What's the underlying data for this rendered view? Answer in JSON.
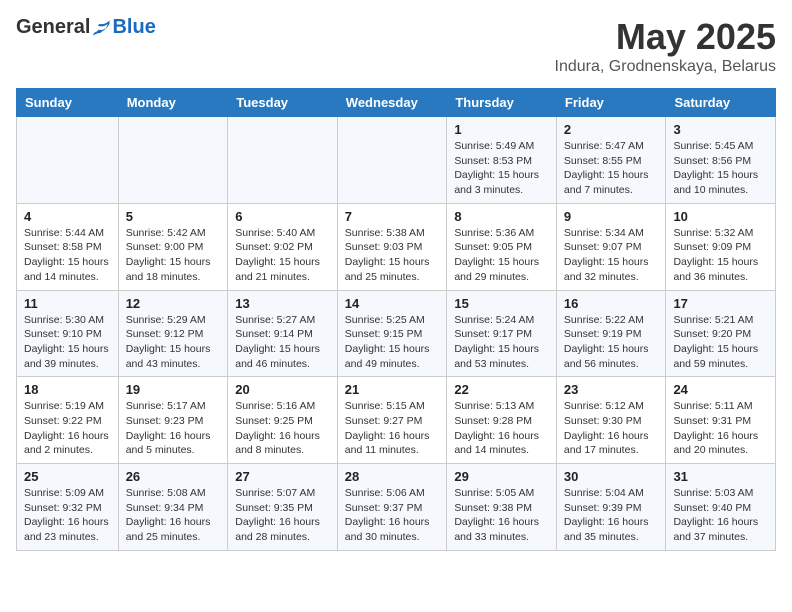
{
  "header": {
    "logo_general": "General",
    "logo_blue": "Blue",
    "month_title": "May 2025",
    "subtitle": "Indura, Grodnenskaya, Belarus"
  },
  "days_of_week": [
    "Sunday",
    "Monday",
    "Tuesday",
    "Wednesday",
    "Thursday",
    "Friday",
    "Saturday"
  ],
  "weeks": [
    [
      {
        "day": "",
        "info": ""
      },
      {
        "day": "",
        "info": ""
      },
      {
        "day": "",
        "info": ""
      },
      {
        "day": "",
        "info": ""
      },
      {
        "day": "1",
        "info": "Sunrise: 5:49 AM\nSunset: 8:53 PM\nDaylight: 15 hours\nand 3 minutes."
      },
      {
        "day": "2",
        "info": "Sunrise: 5:47 AM\nSunset: 8:55 PM\nDaylight: 15 hours\nand 7 minutes."
      },
      {
        "day": "3",
        "info": "Sunrise: 5:45 AM\nSunset: 8:56 PM\nDaylight: 15 hours\nand 10 minutes."
      }
    ],
    [
      {
        "day": "4",
        "info": "Sunrise: 5:44 AM\nSunset: 8:58 PM\nDaylight: 15 hours\nand 14 minutes."
      },
      {
        "day": "5",
        "info": "Sunrise: 5:42 AM\nSunset: 9:00 PM\nDaylight: 15 hours\nand 18 minutes."
      },
      {
        "day": "6",
        "info": "Sunrise: 5:40 AM\nSunset: 9:02 PM\nDaylight: 15 hours\nand 21 minutes."
      },
      {
        "day": "7",
        "info": "Sunrise: 5:38 AM\nSunset: 9:03 PM\nDaylight: 15 hours\nand 25 minutes."
      },
      {
        "day": "8",
        "info": "Sunrise: 5:36 AM\nSunset: 9:05 PM\nDaylight: 15 hours\nand 29 minutes."
      },
      {
        "day": "9",
        "info": "Sunrise: 5:34 AM\nSunset: 9:07 PM\nDaylight: 15 hours\nand 32 minutes."
      },
      {
        "day": "10",
        "info": "Sunrise: 5:32 AM\nSunset: 9:09 PM\nDaylight: 15 hours\nand 36 minutes."
      }
    ],
    [
      {
        "day": "11",
        "info": "Sunrise: 5:30 AM\nSunset: 9:10 PM\nDaylight: 15 hours\nand 39 minutes."
      },
      {
        "day": "12",
        "info": "Sunrise: 5:29 AM\nSunset: 9:12 PM\nDaylight: 15 hours\nand 43 minutes."
      },
      {
        "day": "13",
        "info": "Sunrise: 5:27 AM\nSunset: 9:14 PM\nDaylight: 15 hours\nand 46 minutes."
      },
      {
        "day": "14",
        "info": "Sunrise: 5:25 AM\nSunset: 9:15 PM\nDaylight: 15 hours\nand 49 minutes."
      },
      {
        "day": "15",
        "info": "Sunrise: 5:24 AM\nSunset: 9:17 PM\nDaylight: 15 hours\nand 53 minutes."
      },
      {
        "day": "16",
        "info": "Sunrise: 5:22 AM\nSunset: 9:19 PM\nDaylight: 15 hours\nand 56 minutes."
      },
      {
        "day": "17",
        "info": "Sunrise: 5:21 AM\nSunset: 9:20 PM\nDaylight: 15 hours\nand 59 minutes."
      }
    ],
    [
      {
        "day": "18",
        "info": "Sunrise: 5:19 AM\nSunset: 9:22 PM\nDaylight: 16 hours\nand 2 minutes."
      },
      {
        "day": "19",
        "info": "Sunrise: 5:17 AM\nSunset: 9:23 PM\nDaylight: 16 hours\nand 5 minutes."
      },
      {
        "day": "20",
        "info": "Sunrise: 5:16 AM\nSunset: 9:25 PM\nDaylight: 16 hours\nand 8 minutes."
      },
      {
        "day": "21",
        "info": "Sunrise: 5:15 AM\nSunset: 9:27 PM\nDaylight: 16 hours\nand 11 minutes."
      },
      {
        "day": "22",
        "info": "Sunrise: 5:13 AM\nSunset: 9:28 PM\nDaylight: 16 hours\nand 14 minutes."
      },
      {
        "day": "23",
        "info": "Sunrise: 5:12 AM\nSunset: 9:30 PM\nDaylight: 16 hours\nand 17 minutes."
      },
      {
        "day": "24",
        "info": "Sunrise: 5:11 AM\nSunset: 9:31 PM\nDaylight: 16 hours\nand 20 minutes."
      }
    ],
    [
      {
        "day": "25",
        "info": "Sunrise: 5:09 AM\nSunset: 9:32 PM\nDaylight: 16 hours\nand 23 minutes."
      },
      {
        "day": "26",
        "info": "Sunrise: 5:08 AM\nSunset: 9:34 PM\nDaylight: 16 hours\nand 25 minutes."
      },
      {
        "day": "27",
        "info": "Sunrise: 5:07 AM\nSunset: 9:35 PM\nDaylight: 16 hours\nand 28 minutes."
      },
      {
        "day": "28",
        "info": "Sunrise: 5:06 AM\nSunset: 9:37 PM\nDaylight: 16 hours\nand 30 minutes."
      },
      {
        "day": "29",
        "info": "Sunrise: 5:05 AM\nSunset: 9:38 PM\nDaylight: 16 hours\nand 33 minutes."
      },
      {
        "day": "30",
        "info": "Sunrise: 5:04 AM\nSunset: 9:39 PM\nDaylight: 16 hours\nand 35 minutes."
      },
      {
        "day": "31",
        "info": "Sunrise: 5:03 AM\nSunset: 9:40 PM\nDaylight: 16 hours\nand 37 minutes."
      }
    ]
  ]
}
